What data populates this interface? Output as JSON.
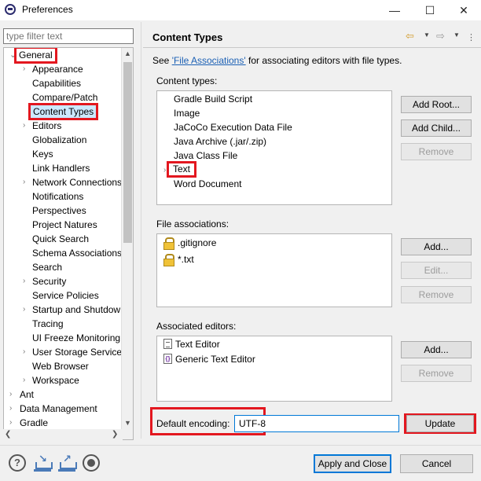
{
  "window": {
    "title": "Preferences",
    "minimize": "—",
    "maximize": "☐",
    "close": "✕"
  },
  "filter": {
    "placeholder": "type filter text"
  },
  "tree": {
    "items": [
      {
        "label": "General",
        "arrow": "⌄"
      },
      {
        "label": "Appearance",
        "arrow": "›"
      },
      {
        "label": "Capabilities"
      },
      {
        "label": "Compare/Patch"
      },
      {
        "label": "Content Types"
      },
      {
        "label": "Editors",
        "arrow": "›"
      },
      {
        "label": "Globalization"
      },
      {
        "label": "Keys"
      },
      {
        "label": "Link Handlers"
      },
      {
        "label": "Network Connections",
        "arrow": "›"
      },
      {
        "label": "Notifications"
      },
      {
        "label": "Perspectives"
      },
      {
        "label": "Project Natures"
      },
      {
        "label": "Quick Search"
      },
      {
        "label": "Schema Associations"
      },
      {
        "label": "Search"
      },
      {
        "label": "Security",
        "arrow": "›"
      },
      {
        "label": "Service Policies"
      },
      {
        "label": "Startup and Shutdown",
        "arrow": "›"
      },
      {
        "label": "Tracing"
      },
      {
        "label": "UI Freeze Monitoring"
      },
      {
        "label": "User Storage Service",
        "arrow": "›"
      },
      {
        "label": "Web Browser"
      },
      {
        "label": "Workspace",
        "arrow": "›"
      },
      {
        "label": "Ant",
        "arrow": "›"
      },
      {
        "label": "Data Management",
        "arrow": "›"
      },
      {
        "label": "Gradle",
        "arrow": "›"
      }
    ]
  },
  "page": {
    "title": "Content Types",
    "description_prefix": "See ",
    "description_link": "'File Associations'",
    "description_suffix": " for associating editors with file types.",
    "content_types_label": "Content types:",
    "content_types": [
      "Gradle Build Script",
      "Image",
      "JaCoCo Execution Data File",
      "Java Archive (.jar/.zip)",
      "Java Class File",
      "Text",
      "Word Document"
    ],
    "content_type_buttons": {
      "add_root": "Add Root...",
      "add_child": "Add Child...",
      "remove": "Remove"
    },
    "file_associations_label": "File associations:",
    "file_associations": [
      ".gitignore",
      "*.txt"
    ],
    "file_assoc_buttons": {
      "add": "Add...",
      "edit": "Edit...",
      "remove": "Remove"
    },
    "associated_editors_label": "Associated editors:",
    "associated_editors": [
      "Text Editor",
      "Generic Text Editor"
    ],
    "editor_buttons": {
      "add": "Add...",
      "remove": "Remove"
    },
    "default_encoding_label": "Default encoding:",
    "default_encoding_value": "UTF-8",
    "update_button": "Update"
  },
  "footer": {
    "apply_and_close": "Apply and Close",
    "cancel": "Cancel"
  },
  "colors": {
    "highlight": "#e3171f",
    "selection": "#cce8ff",
    "link": "#1a5fb4"
  }
}
